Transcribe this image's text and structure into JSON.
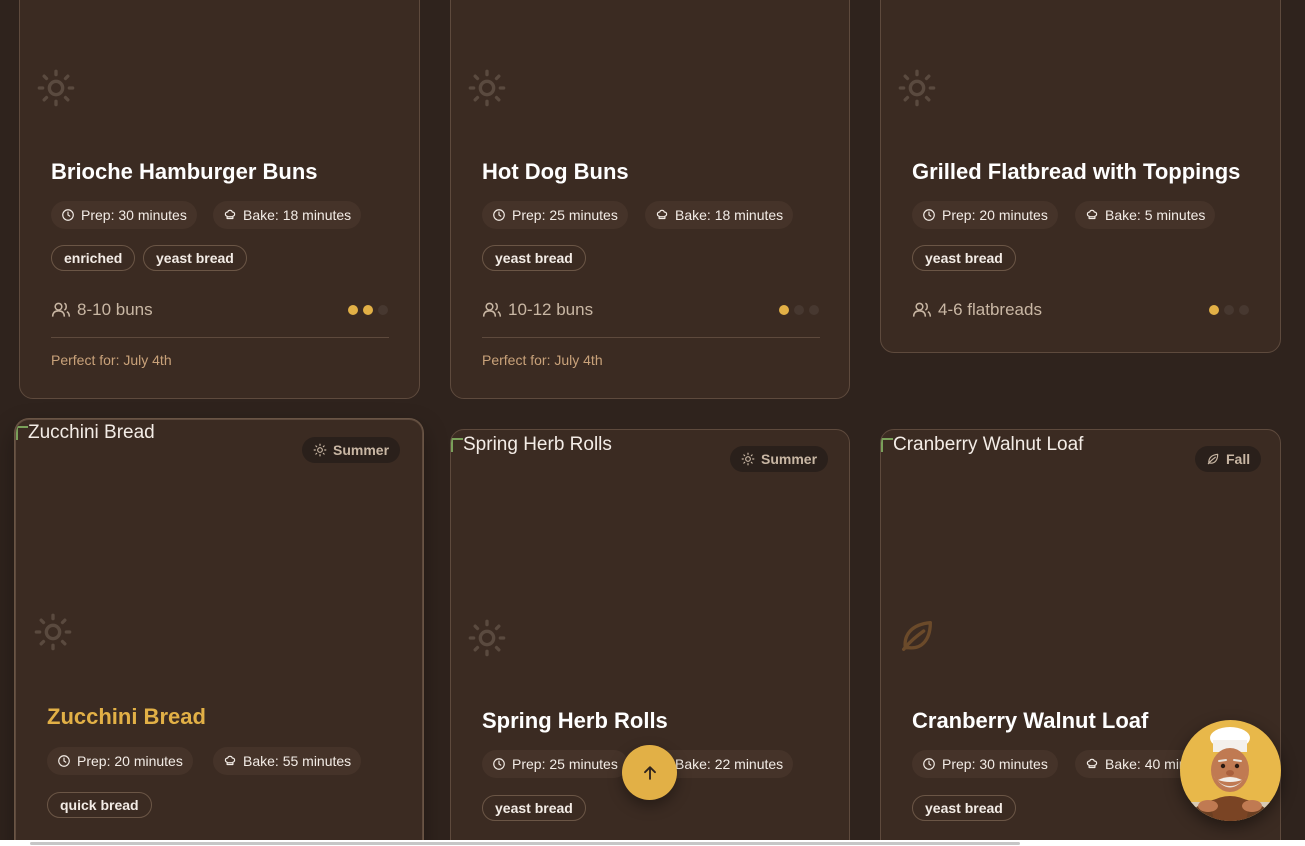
{
  "cards": [
    {
      "title": "Brioche Hamburger Buns",
      "prep": "Prep: 30 minutes",
      "bake": "Bake: 18 minutes",
      "tags": [
        "enriched",
        "yeast bread"
      ],
      "servings": "8-10 buns",
      "difficulty": 2,
      "occasion": "Perfect for: July 4th",
      "season_icon": "sun-icon"
    },
    {
      "title": "Hot Dog Buns",
      "prep": "Prep: 25 minutes",
      "bake": "Bake: 18 minutes",
      "tags": [
        "yeast bread"
      ],
      "servings": "10-12 buns",
      "difficulty": 1,
      "occasion": "Perfect for: July 4th",
      "season_icon": "sun-icon"
    },
    {
      "title": "Grilled Flatbread with Toppings",
      "prep": "Prep: 20 minutes",
      "bake": "Bake: 5 minutes",
      "tags": [
        "yeast bread"
      ],
      "servings": "4-6 flatbreads",
      "difficulty": 1,
      "season_icon": "sun-icon"
    },
    {
      "image_alt": "Zucchini Bread",
      "season": "Summer",
      "title": "Zucchini Bread",
      "prep": "Prep: 20 minutes",
      "bake": "Bake: 55 minutes",
      "tags": [
        "quick bread"
      ],
      "season_icon": "sun-icon"
    },
    {
      "image_alt": "Spring Herb Rolls",
      "season": "Summer",
      "title": "Spring Herb Rolls",
      "prep": "Prep: 25 minutes",
      "bake": "Bake: 22 minutes",
      "tags": [
        "yeast bread"
      ],
      "season_icon": "sun-icon"
    },
    {
      "image_alt": "Cranberry Walnut Loaf",
      "season": "Fall",
      "title": "Cranberry Walnut Loaf",
      "prep": "Prep: 30 minutes",
      "bake": "Bake: 40 minutes",
      "tags": [
        "yeast bread"
      ],
      "season_icon": "leaf-icon"
    }
  ],
  "colors": {
    "background": "#2f231d",
    "card": "#3b2b22",
    "accent": "#e2b046",
    "muted_text": "#c9b7a4"
  },
  "floating": {
    "scroll_top_icon": "arrow-up-icon",
    "assistant_icon": "chef-avatar-icon"
  }
}
